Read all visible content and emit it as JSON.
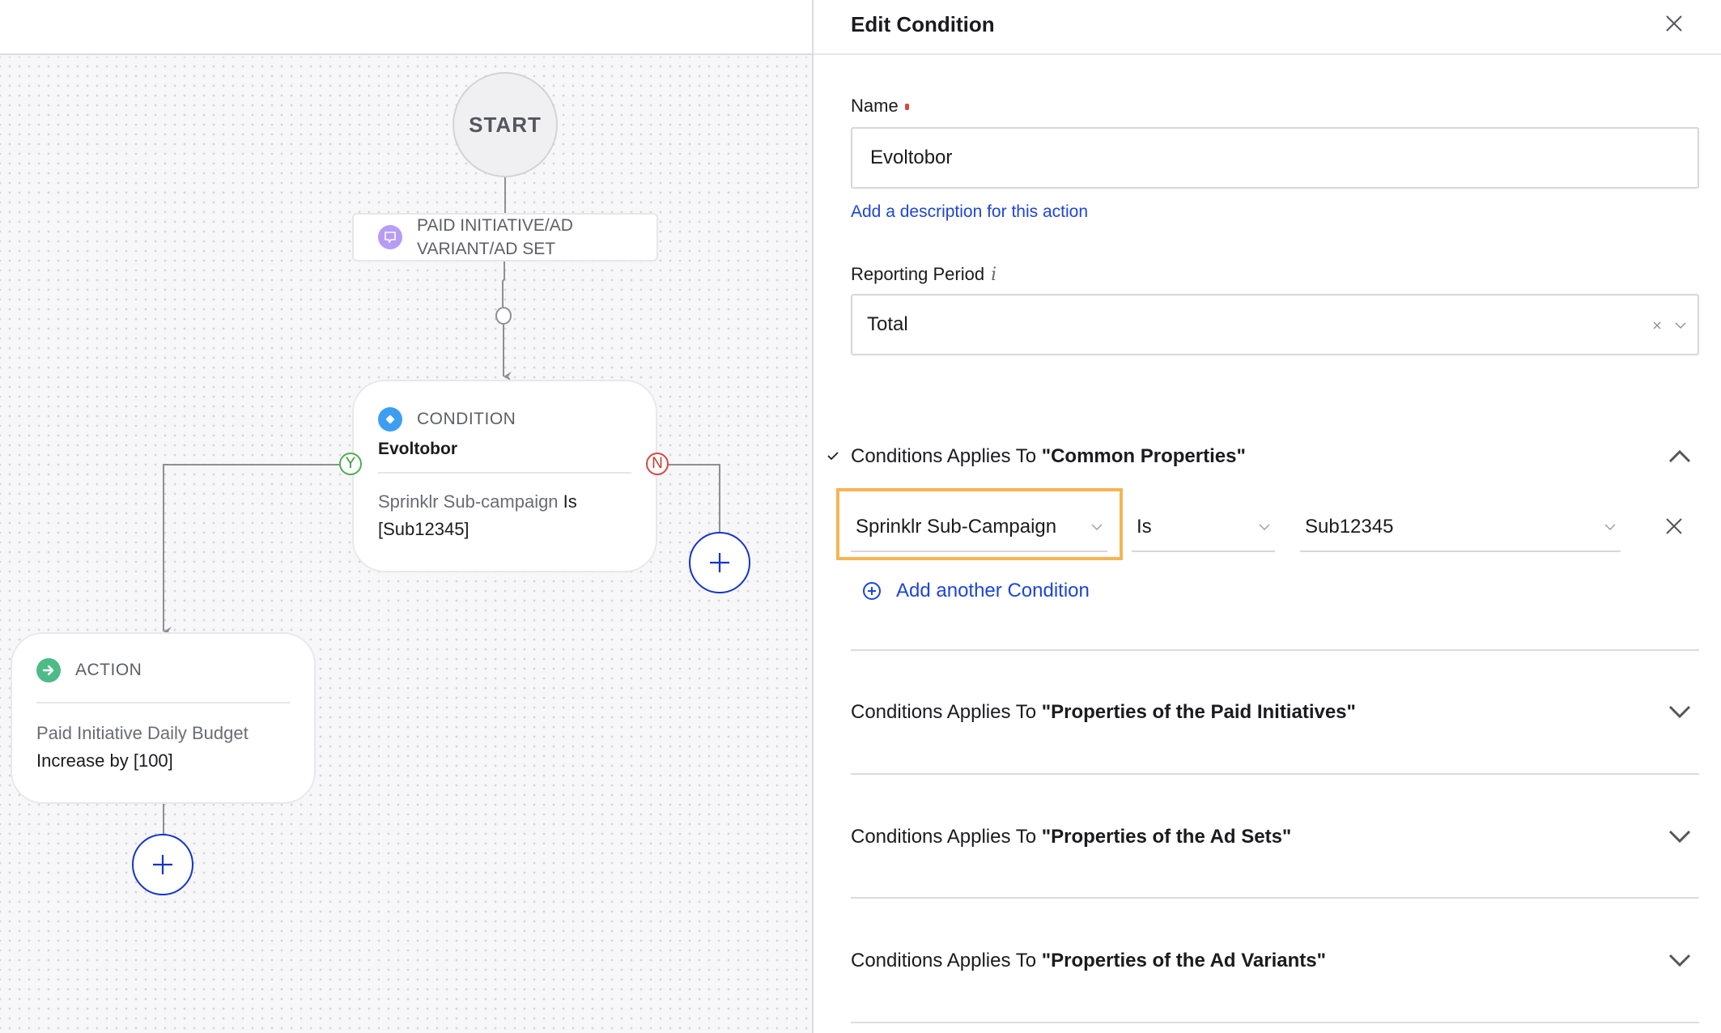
{
  "canvas": {
    "start_label": "START",
    "trigger": {
      "icon": "chat-bubble-icon",
      "label_line1": "PAID INITIATIVE/AD",
      "label_line2": "VARIANT/AD SET"
    },
    "condition_node": {
      "type_label": "CONDITION",
      "icon": "diamond-icon",
      "name": "Evoltobor",
      "field_text": "Sprinklr Sub-campaign",
      "operator_text": "Is",
      "value_text": "[Sub12345]",
      "yes_label": "Y",
      "no_label": "N"
    },
    "action_node": {
      "type_label": "ACTION",
      "icon": "arrow-right-circle-icon",
      "line1": "Paid Initiative Daily Budget",
      "line2": "Increase by [100]"
    },
    "add_step_icon": "plus-icon"
  },
  "panel": {
    "title": "Edit Condition",
    "close_icon": "close-icon",
    "name_label": "Name",
    "name_value": "Evoltobor",
    "add_description_link": "Add a description for this action",
    "reporting_period_label": "Reporting Period",
    "reporting_period_info": "i",
    "reporting_period_value": "Total",
    "sections": [
      {
        "prefix": "Conditions Applies To ",
        "target": "\"Common Properties\"",
        "expanded": true,
        "complete": true
      },
      {
        "prefix": "Conditions Applies To ",
        "target": "\"Properties of the Paid Initiatives\"",
        "expanded": false
      },
      {
        "prefix": "Conditions Applies To ",
        "target": "\"Properties of the Ad Sets\"",
        "expanded": false
      },
      {
        "prefix": "Conditions Applies To ",
        "target": "\"Properties of the Ad Variants\"",
        "expanded": false
      }
    ],
    "condition_row": {
      "field": "Sprinklr Sub-Campaign",
      "operator": "Is",
      "value": "Sub12345"
    },
    "add_condition_label": "Add another Condition"
  },
  "colors": {
    "accent_blue": "#1434cb",
    "link_blue": "#1d45d8",
    "highlight_orange": "#f5b552",
    "yes_green": "#4caf50",
    "no_red": "#d9473f",
    "trigger_purple": "#b79cf5",
    "condition_blue": "#3d9df3",
    "action_green": "#4dbb87"
  }
}
